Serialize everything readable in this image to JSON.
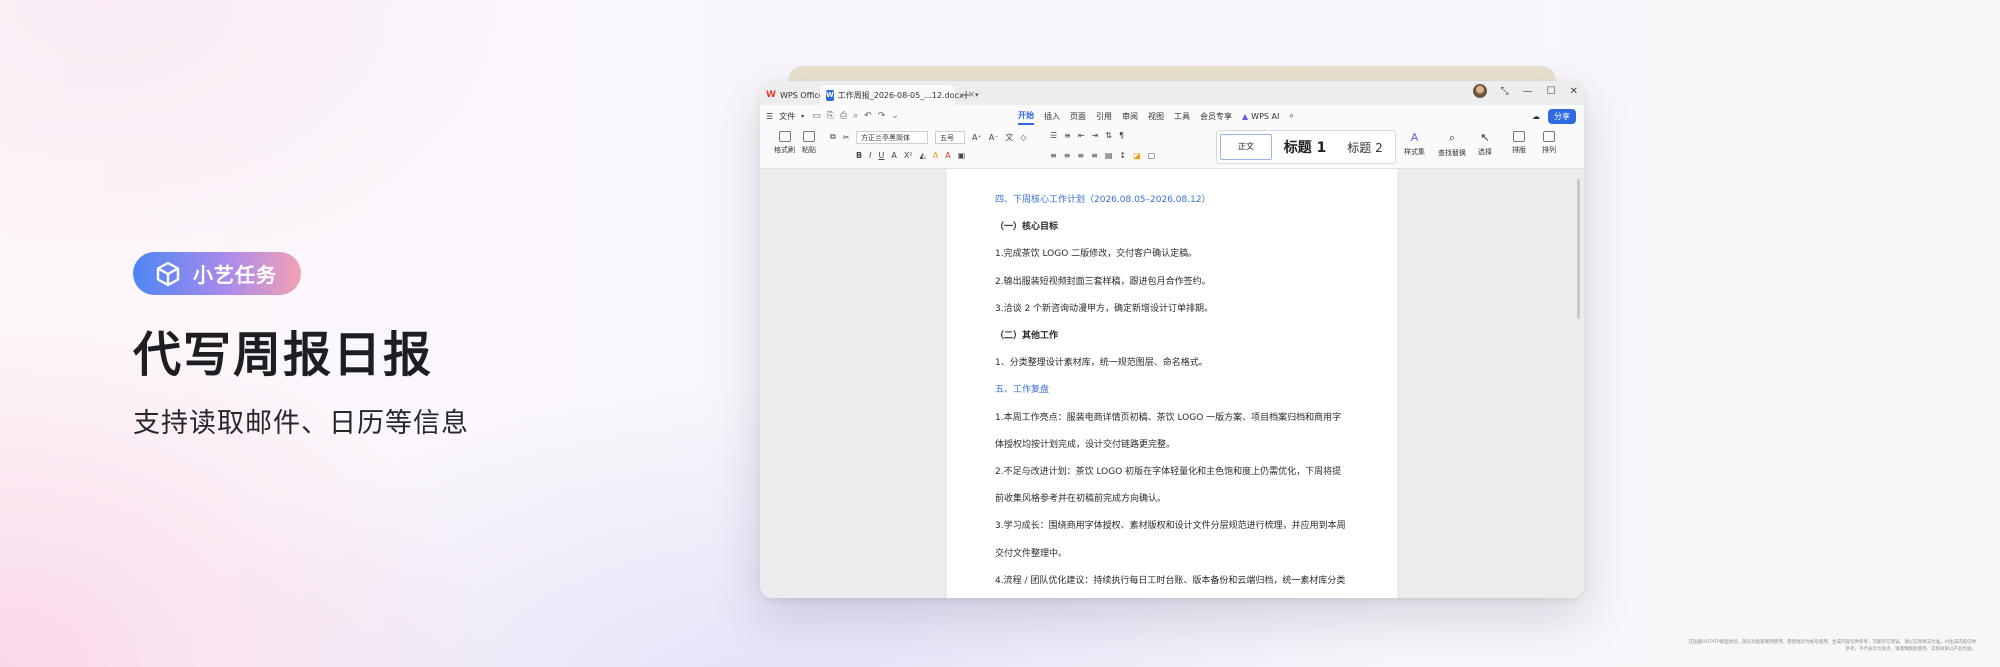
{
  "promo": {
    "badge": "小艺任务",
    "headline": "代写周报日报",
    "subline": "支持读取邮件、日历等信息"
  },
  "window": {
    "tabs": [
      {
        "label": "WPS Office"
      },
      {
        "label": "工作周报_2026-08-05_...12.docx"
      }
    ],
    "menu": {
      "file": "文件",
      "tabs": [
        "开始",
        "插入",
        "页面",
        "引用",
        "审阅",
        "视图",
        "工具",
        "会员专享"
      ],
      "wps_ai": "WPS AI",
      "share": "分享"
    },
    "ribbon": {
      "format_painter": "格式刷",
      "paste": "粘贴",
      "font_name": "方正兰亭黑简体",
      "font_size": "五号",
      "style_normal": "正文",
      "style_h1": "标题 1",
      "style_h2": "标题 2",
      "styles_label": "样式集",
      "find_replace": "查找替换",
      "select": "选择",
      "arrange": "排版",
      "extra": "排列"
    },
    "document": {
      "lines": [
        "四、下周核心工作计划（2026.08.05–2026.08.12）",
        "（一）核心目标",
        "1.完成茶饮 LOGO 二版修改，交付客户确认定稿。",
        "2.输出服装短视频封面三套样稿，跟进包月合作签约。",
        "3.洽谈 2 个新咨询动漫甲方，确定新增设计订单排期。",
        "（二）其他工作",
        "1、分类整理设计素材库，统一规范图层、命名格式。",
        "五、工作复盘",
        "1.本周工作亮点：服装电商详情页初稿、茶饮 LOGO 一版方案、项目档案归档和商用字",
        "体授权均按计划完成，设计交付链路更完整。",
        "2.不足与改进计划：茶饮 LOGO 初版在字体轻量化和主色饱和度上仍需优化，下周将提",
        "前收集风格参考并在初稿前完成方向确认。",
        "3.学习成长：围绕商用字体授权、素材版权和设计文件分层规范进行梳理，并应用到本周",
        "交付文件整理中。",
        "4.流程 / 团队优化建议：持续执行每日工时台账、版本备份和云端归档，统一素材库分类"
      ]
    }
  },
  "disclaimer": "在国服HOTATP版型体验，部分功能需联网使用，需登陆华为帐号使用，生成内容仅供参考，可能存在错误，请以实际情况为准。AI生成内容仅供参考，不代表华为观点，请谨慎甄别使用，实际效果以产品为准。"
}
